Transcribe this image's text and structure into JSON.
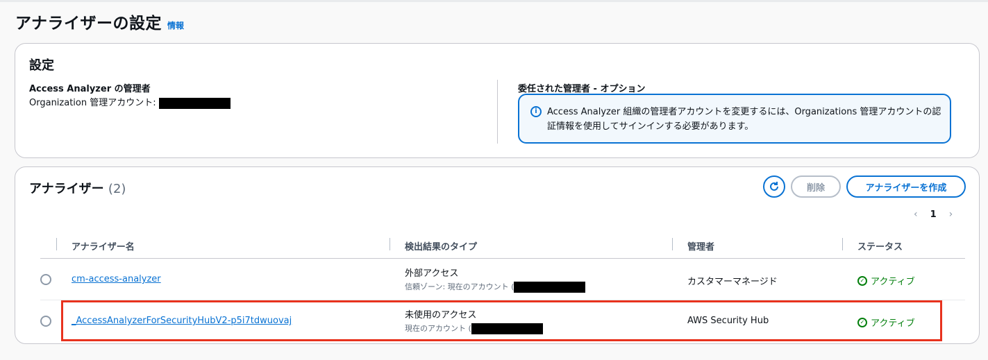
{
  "header": {
    "title": "アナライザーの設定",
    "info_link": "情報"
  },
  "settings": {
    "title": "設定",
    "admin_label": "Access Analyzer の管理者",
    "admin_value_label": "Organization 管理アカウント:",
    "delegated_label": "委任された管理者 - オプション",
    "alert_text": "Access Analyzer 組織の管理者アカウントを変更するには、Organizations 管理アカウントの認証情報を使用してサインインする必要があります。",
    "alert_icon": "info-icon"
  },
  "analyzers": {
    "title": "アナライザー",
    "count": "(2)",
    "refresh_icon": "refresh-icon",
    "delete_label": "削除",
    "create_label": "アナライザーを作成",
    "pagination": {
      "prev": "‹",
      "page": "1",
      "next": "›"
    },
    "columns": [
      "アナライザー名",
      "検出結果のタイプ",
      "管理者",
      "ステータス"
    ],
    "rows": [
      {
        "name": "cm-access-analyzer",
        "finding_type": "外部アクセス",
        "finding_sub": "信頼ゾーン: 現在のアカウント (",
        "manager": "カスタマーマネージド",
        "status": "アクティブ"
      },
      {
        "name": "_AccessAnalyzerForSecurityHubV2-p5i7tdwuovaj",
        "finding_type": "未使用のアクセス",
        "finding_sub": "現在のアカウント (",
        "manager": "AWS Security Hub",
        "status": "アクティブ"
      }
    ]
  },
  "colors": {
    "link": "#0972d3",
    "success": "#037f0c",
    "highlight": "#e8321e"
  }
}
